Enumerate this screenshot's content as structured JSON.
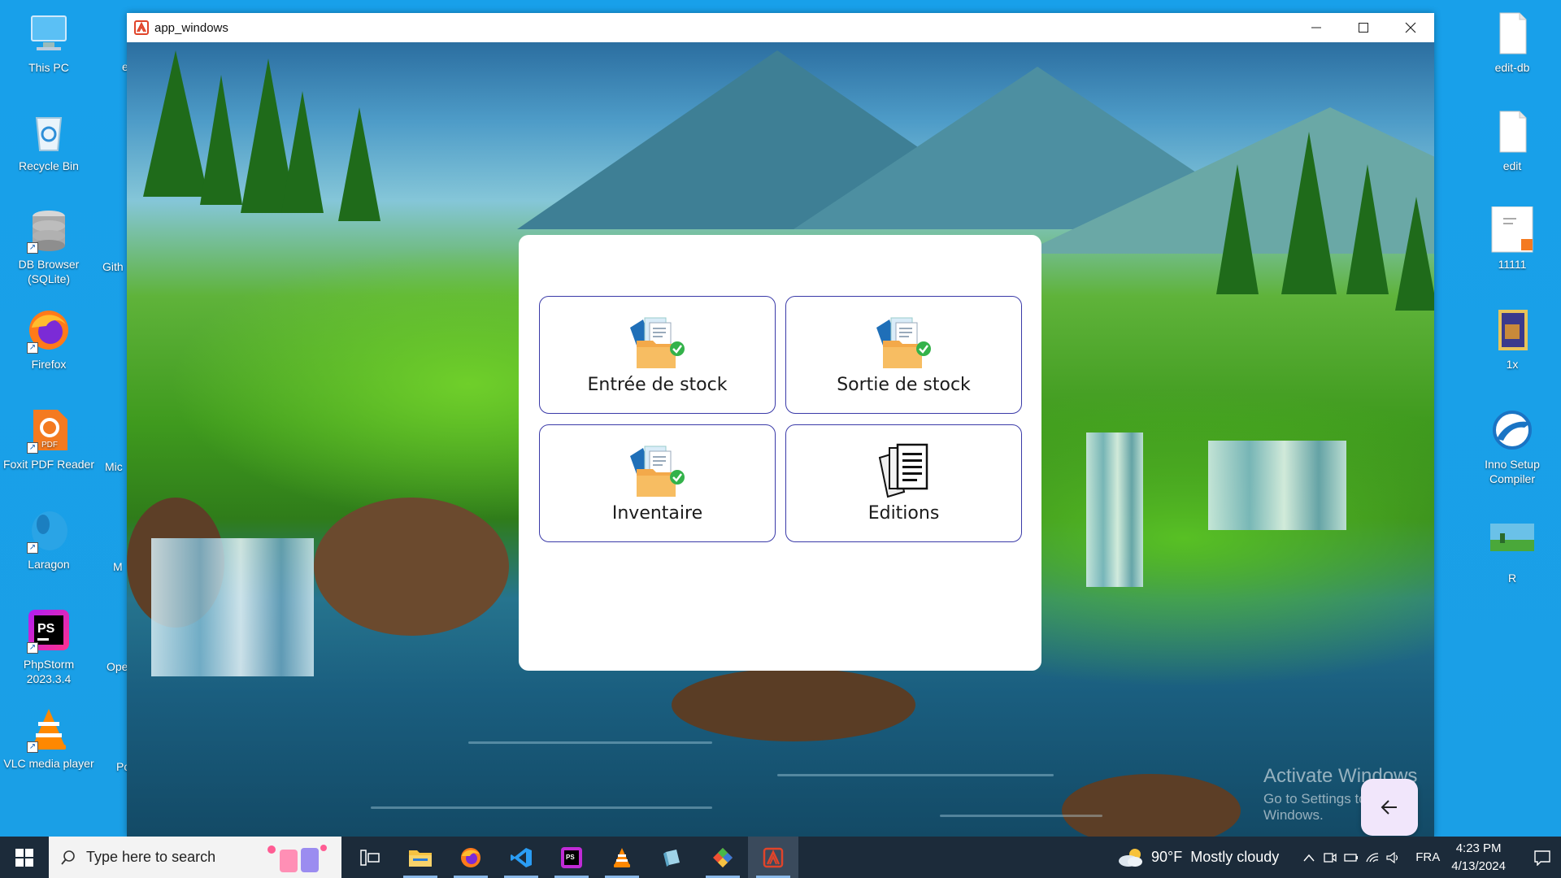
{
  "desktop": {
    "left_icons": [
      {
        "label": "This PC",
        "icon": "computer-icon"
      },
      {
        "label": "Recycle Bin",
        "icon": "recycle-bin-icon"
      },
      {
        "label": "DB Browser (SQLite)",
        "icon": "database-icon"
      },
      {
        "label": "Firefox",
        "icon": "firefox-icon"
      },
      {
        "label": "Foxit PDF Reader",
        "icon": "pdf-reader-icon"
      },
      {
        "label": "Laragon",
        "icon": "laragon-icon"
      },
      {
        "label": "PhpStorm 2023.3.4",
        "icon": "phpstorm-icon"
      },
      {
        "label": "VLC media player",
        "icon": "vlc-icon"
      }
    ],
    "partial_labels": [
      "e",
      "Gith",
      "Mic",
      "M",
      "Ope",
      "Po"
    ],
    "right_icons": [
      {
        "label": "edit-db",
        "icon": "document-icon"
      },
      {
        "label": "edit",
        "icon": "document-icon"
      },
      {
        "label": "11111",
        "icon": "pdf-file-icon"
      },
      {
        "label": "1x",
        "icon": "image-file-icon"
      },
      {
        "label": "Inno Setup Compiler",
        "icon": "inno-setup-icon"
      },
      {
        "label": "R",
        "icon": "image-thumbnail-icon"
      }
    ]
  },
  "window": {
    "title": "app_windows",
    "buttons": [
      "minimize",
      "maximize",
      "close"
    ]
  },
  "menu": {
    "items": [
      {
        "label": "Entrée de stock",
        "icon": "folder-documents-check-icon"
      },
      {
        "label": "Sortie de stock",
        "icon": "folder-documents-check-icon"
      },
      {
        "label": "Inventaire",
        "icon": "folder-documents-check-icon"
      },
      {
        "label": "Editions",
        "icon": "documents-stack-icon"
      }
    ]
  },
  "watermark": {
    "line1": "Activate Windows",
    "line2": "Go to Settings to activate Windows."
  },
  "taskbar": {
    "search_placeholder": "Type here to search",
    "weather": {
      "temp": "90°F",
      "condition": "Mostly cloudy"
    },
    "language": "FRA",
    "time": "4:23 PM",
    "date": "4/13/2024"
  }
}
